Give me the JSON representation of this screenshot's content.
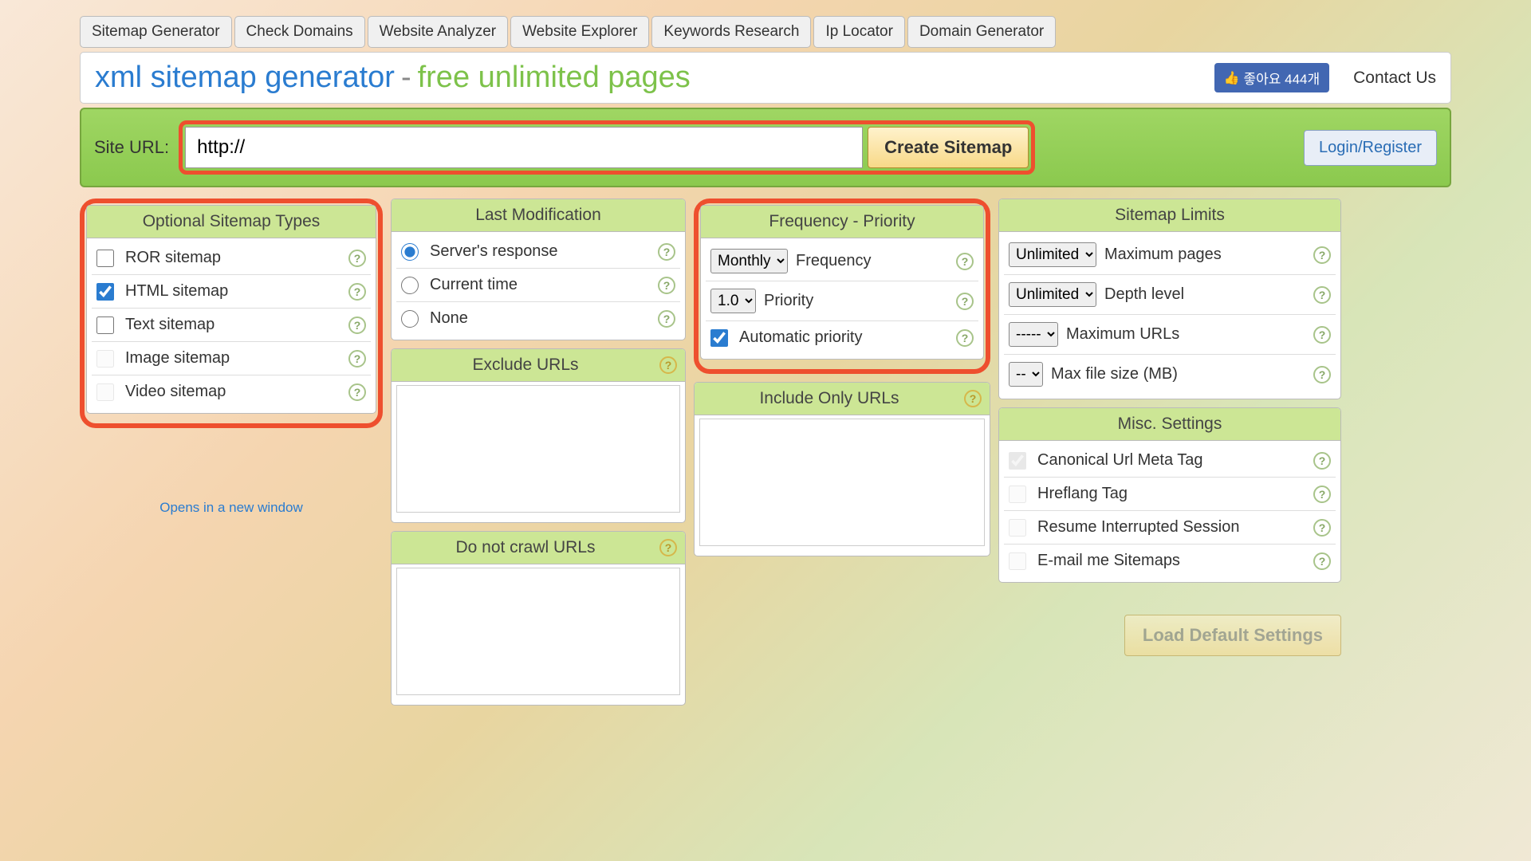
{
  "nav": [
    "Sitemap Generator",
    "Check Domains",
    "Website Analyzer",
    "Website Explorer",
    "Keywords Research",
    "Ip Locator",
    "Domain Generator"
  ],
  "header": {
    "title_blue": "xml sitemap generator",
    "title_dash": "-",
    "title_green": "free unlimited pages",
    "like_label": "좋아요 444개",
    "contact": "Contact Us"
  },
  "urlbar": {
    "label": "Site URL:",
    "value": "http://",
    "create": "Create Sitemap",
    "login": "Login/Register"
  },
  "optional_types": {
    "title": "Optional Sitemap Types",
    "items": [
      {
        "label": "ROR sitemap",
        "checked": false,
        "disabled": false
      },
      {
        "label": "HTML sitemap",
        "checked": true,
        "disabled": false
      },
      {
        "label": "Text sitemap",
        "checked": false,
        "disabled": false
      },
      {
        "label": "Image sitemap",
        "checked": false,
        "disabled": true
      },
      {
        "label": "Video sitemap",
        "checked": false,
        "disabled": true
      }
    ]
  },
  "lastmod": {
    "title": "Last Modification",
    "items": [
      {
        "label": "Server's response",
        "checked": true
      },
      {
        "label": "Current time",
        "checked": false
      },
      {
        "label": "None",
        "checked": false
      }
    ]
  },
  "freq": {
    "title": "Frequency - Priority",
    "freq_select": "Monthly",
    "freq_label": "Frequency",
    "prio_select": "1.0",
    "prio_label": "Priority",
    "auto_label": "Automatic priority",
    "auto_checked": true
  },
  "exclude": {
    "title": "Exclude URLs"
  },
  "include": {
    "title": "Include Only URLs"
  },
  "donotcrawl": {
    "title": "Do not crawl URLs"
  },
  "limits": {
    "title": "Sitemap Limits",
    "rows": [
      {
        "select": "Unlimited",
        "label": "Maximum pages"
      },
      {
        "select": "Unlimited",
        "label": "Depth level"
      },
      {
        "select": "-----",
        "label": "Maximum URLs"
      },
      {
        "select": "--",
        "label": "Max file size (MB)"
      }
    ]
  },
  "misc": {
    "title": "Misc. Settings",
    "items": [
      {
        "label": "Canonical Url Meta Tag",
        "checked": true,
        "disabled": true
      },
      {
        "label": "Hreflang Tag",
        "checked": false,
        "disabled": true
      },
      {
        "label": "Resume Interrupted Session",
        "checked": false,
        "disabled": true
      },
      {
        "label": "E-mail me Sitemaps",
        "checked": false,
        "disabled": true
      }
    ]
  },
  "open_window": "Opens in a new window",
  "load_defaults": "Load Default Settings"
}
